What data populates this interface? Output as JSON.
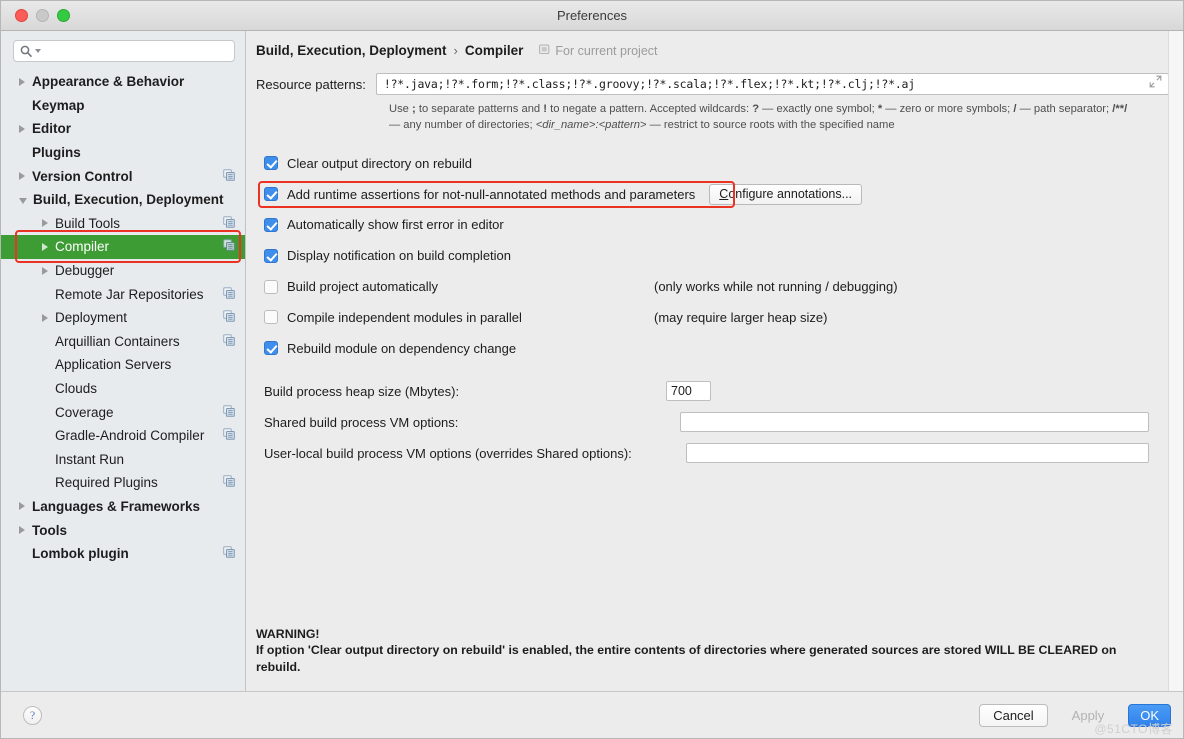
{
  "window": {
    "title": "Preferences",
    "traffic_lights": [
      "close",
      "minimize",
      "zoom"
    ]
  },
  "sidebar": {
    "search": {
      "value": "",
      "placeholder": ""
    },
    "items": [
      {
        "label": "Appearance & Behavior",
        "indent": 0,
        "arrow": "closed",
        "bold": true,
        "copy": false,
        "selected": false
      },
      {
        "label": "Keymap",
        "indent": 0,
        "arrow": "none",
        "bold": true,
        "copy": false,
        "selected": false
      },
      {
        "label": "Editor",
        "indent": 0,
        "arrow": "closed",
        "bold": true,
        "copy": false,
        "selected": false
      },
      {
        "label": "Plugins",
        "indent": 0,
        "arrow": "none",
        "bold": true,
        "copy": false,
        "selected": false
      },
      {
        "label": "Version Control",
        "indent": 0,
        "arrow": "closed",
        "bold": true,
        "copy": true,
        "selected": false
      },
      {
        "label": "Build, Execution, Deployment",
        "indent": 0,
        "arrow": "open",
        "bold": true,
        "copy": false,
        "selected": false
      },
      {
        "label": "Build Tools",
        "indent": 1,
        "arrow": "closed",
        "bold": false,
        "copy": true,
        "selected": false
      },
      {
        "label": "Compiler",
        "indent": 1,
        "arrow": "closed",
        "bold": false,
        "copy": true,
        "selected": true
      },
      {
        "label": "Debugger",
        "indent": 1,
        "arrow": "closed",
        "bold": false,
        "copy": false,
        "selected": false
      },
      {
        "label": "Remote Jar Repositories",
        "indent": 1,
        "arrow": "none",
        "bold": false,
        "copy": true,
        "selected": false
      },
      {
        "label": "Deployment",
        "indent": 1,
        "arrow": "closed",
        "bold": false,
        "copy": true,
        "selected": false
      },
      {
        "label": "Arquillian Containers",
        "indent": 1,
        "arrow": "none",
        "bold": false,
        "copy": true,
        "selected": false
      },
      {
        "label": "Application Servers",
        "indent": 1,
        "arrow": "none",
        "bold": false,
        "copy": false,
        "selected": false
      },
      {
        "label": "Clouds",
        "indent": 1,
        "arrow": "none",
        "bold": false,
        "copy": false,
        "selected": false
      },
      {
        "label": "Coverage",
        "indent": 1,
        "arrow": "none",
        "bold": false,
        "copy": true,
        "selected": false
      },
      {
        "label": "Gradle-Android Compiler",
        "indent": 1,
        "arrow": "none",
        "bold": false,
        "copy": true,
        "selected": false
      },
      {
        "label": "Instant Run",
        "indent": 1,
        "arrow": "none",
        "bold": false,
        "copy": false,
        "selected": false
      },
      {
        "label": "Required Plugins",
        "indent": 1,
        "arrow": "none",
        "bold": false,
        "copy": true,
        "selected": false
      },
      {
        "label": "Languages & Frameworks",
        "indent": 0,
        "arrow": "closed",
        "bold": true,
        "copy": false,
        "selected": false
      },
      {
        "label": "Tools",
        "indent": 0,
        "arrow": "closed",
        "bold": true,
        "copy": false,
        "selected": false
      },
      {
        "label": "Lombok plugin",
        "indent": 0,
        "arrow": "none",
        "bold": true,
        "copy": true,
        "selected": false
      }
    ]
  },
  "content": {
    "breadcrumb": {
      "root": "Build, Execution, Deployment",
      "separator": "›",
      "current": "Compiler"
    },
    "scope_label": "For current project",
    "resource_patterns": {
      "label": "Resource patterns:",
      "value": "!?*.java;!?*.form;!?*.class;!?*.groovy;!?*.scala;!?*.flex;!?*.kt;!?*.clj;!?*.aj",
      "hint_line1_parts": [
        "Use ",
        ";",
        " to separate patterns and ",
        "!",
        " to negate a pattern. Accepted wildcards: ",
        "?",
        " — exactly one symbol; ",
        "*",
        " — zero or more symbols; ",
        "/",
        " — path separator; ",
        "/**/"
      ],
      "hint_line2_parts": [
        "— any number of directories; ",
        "<dir_name>:<pattern>",
        " — restrict to source roots with the specified name"
      ]
    },
    "checkboxes": [
      {
        "label": "Clear output directory on rebuild",
        "checked": true,
        "note": "",
        "highlighted": false
      },
      {
        "label": "Add runtime assertions for not-null-annotated methods and parameters",
        "checked": true,
        "note": "",
        "highlighted": true,
        "button": "Configure annotations..."
      },
      {
        "label": "Automatically show first error in editor",
        "checked": true,
        "note": "",
        "highlighted": false
      },
      {
        "label": "Display notification on build completion",
        "checked": true,
        "note": "",
        "highlighted": false
      },
      {
        "label": "Build project automatically",
        "checked": false,
        "note": "(only works while not running / debugging)",
        "highlighted": false
      },
      {
        "label": "Compile independent modules in parallel",
        "checked": false,
        "note": "(may require larger heap size)",
        "highlighted": false
      },
      {
        "label": "Rebuild module on dependency change",
        "checked": true,
        "note": "",
        "highlighted": false
      }
    ],
    "fields": [
      {
        "label": "Build process heap size (Mbytes):",
        "value": "700",
        "size": "small"
      },
      {
        "label": "Shared build process VM options:",
        "value": "",
        "size": "wide"
      },
      {
        "label": "User-local build process VM options (overrides Shared options):",
        "value": "",
        "size": "wide"
      }
    ],
    "warning": {
      "title": "WARNING!",
      "text": "If option 'Clear output directory on rebuild' is enabled, the entire contents of directories where generated sources are stored WILL BE CLEARED on rebuild."
    }
  },
  "footer": {
    "help": "?",
    "cancel": "Cancel",
    "apply": "Apply",
    "ok": "OK",
    "watermark": "@51CTO博客"
  },
  "colors": {
    "selection_green": "#3e9c35",
    "annotation_red": "#ec3323",
    "checkbox_blue": "#3f8eec",
    "primary_button": "#2f82ec"
  }
}
